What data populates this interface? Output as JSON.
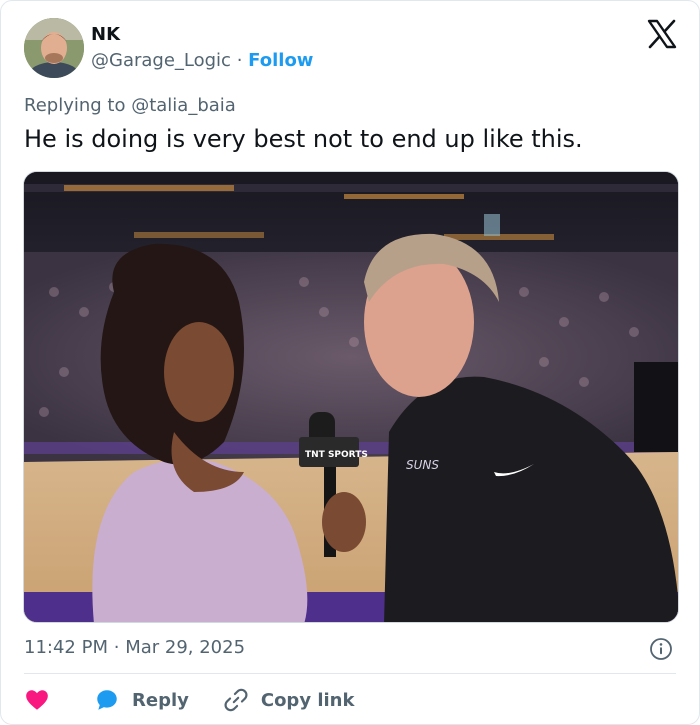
{
  "author": {
    "name": "NK",
    "handle": "@Garage_Logic",
    "separator": "·",
    "follow_label": "Follow"
  },
  "reply": {
    "prefix": "Replying to",
    "mention": "@talia_baia"
  },
  "tweet": {
    "text": "He is doing is very best not to end up like this.",
    "time": "11:42 PM",
    "separator": "·",
    "date": "Mar 29, 2025"
  },
  "media": {
    "mic_flag_text": "TNT SPORTS",
    "jersey_text": "SUNS"
  },
  "actions": {
    "reply_label": "Reply",
    "copy_link_label": "Copy link"
  },
  "icons": {
    "logo": "x-logo-icon",
    "info": "info-icon",
    "like": "heart-icon",
    "reply": "speech-bubble-icon",
    "copy": "link-icon"
  },
  "colors": {
    "accent": "#1d9bf0",
    "text": "#0f1419",
    "muted": "#536471",
    "like": "#f91880",
    "reply_icon": "#1d9bf0"
  }
}
